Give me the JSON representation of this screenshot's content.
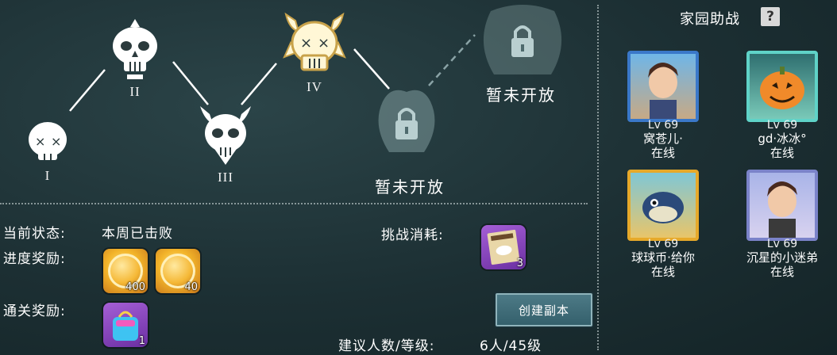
{
  "bosses": [
    {
      "numeral": "I"
    },
    {
      "numeral": "II"
    },
    {
      "numeral": "III"
    },
    {
      "numeral": "IV"
    }
  ],
  "locked_label": "暂未开放",
  "status": {
    "current_label": "当前状态:",
    "current_value": "本周已击败",
    "progress_label": "进度奖励:",
    "clear_label": "通关奖励:",
    "cost_label": "挑战消耗:",
    "recommend_label": "建议人数/等级:",
    "recommend_value": "6人/45级"
  },
  "progress_rewards": [
    {
      "icon": "gold-coin-icon",
      "qty": "400"
    },
    {
      "icon": "gold-coin-icon",
      "qty": "40"
    }
  ],
  "clear_rewards": [
    {
      "icon": "blue-gift-bag-icon",
      "qty": "1"
    }
  ],
  "cost_items": [
    {
      "icon": "wanted-poster-icon",
      "qty": "3"
    }
  ],
  "create_button": "创建副本",
  "panel": {
    "title": "家园助战",
    "help": "?"
  },
  "friends": [
    {
      "level": "Lv 69",
      "name": "窝苍儿·",
      "status": "在线",
      "frame": "#3a78c9"
    },
    {
      "level": "Lv 69",
      "name": "gd·冰冰°",
      "status": "在线",
      "frame": "#5fd3c8"
    },
    {
      "level": "Lv 69",
      "name": "球球币·给你",
      "status": "在线",
      "frame": "#e6a92a"
    },
    {
      "level": "Lv 69",
      "name": "沉星的小迷弟",
      "status": "在线",
      "frame": "#7b83c9"
    }
  ],
  "colors": {
    "bg": "#1c2f33",
    "button": "#3f6d79",
    "text": "#ffffff"
  }
}
